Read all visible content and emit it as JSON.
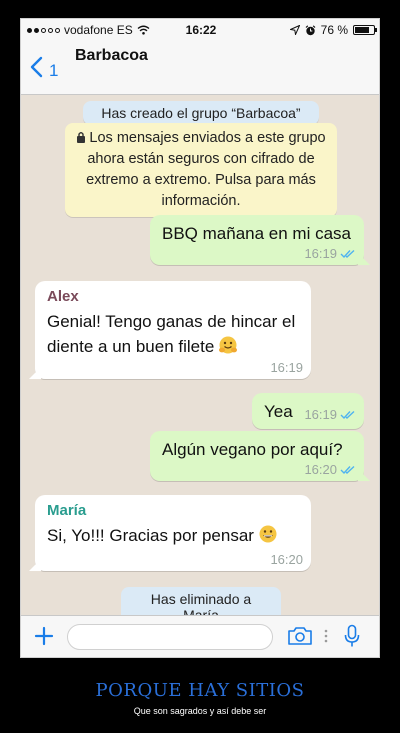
{
  "status_bar": {
    "carrier": "vodafone ES",
    "time": "16:22",
    "battery": "76 %",
    "battery_level": 0.76
  },
  "header": {
    "back_count": "1",
    "chat_title": "Barbacoa"
  },
  "chat": {
    "system_created": "Has creado el grupo “Barbacoa”",
    "encryption_notice": "Los mensajes enviados a este grupo ahora están seguros con cifrado de extremo a extremo. Pulsa para más información.",
    "messages": [
      {
        "text": "BBQ mañana en mi casa",
        "time": "16:19"
      },
      {
        "sender": "Alex",
        "sender_color": "#7a4a5a",
        "text": "Genial! Tengo ganas de hincar el diente a un buen filete",
        "emoji": "hugging-face-emoji",
        "time": "16:19"
      },
      {
        "text": "Yea",
        "time": "16:19"
      },
      {
        "text": "Algún vegano por aquí?",
        "time": "16:20"
      },
      {
        "sender": "María",
        "sender_color": "#2a9d8f",
        "text": "Si, Yo!!! Gracias por pensar",
        "emoji": "grinning-face-emoji",
        "time": "16:20"
      }
    ],
    "system_removed": "Has eliminado a María"
  },
  "input_bar": {
    "placeholder": "",
    "icons": [
      "plus-icon",
      "camera-icon",
      "more-dots-icon",
      "microphone-icon"
    ]
  },
  "colors": {
    "accent": "#1a7de8",
    "outgoing_bubble": "#dcf8c6",
    "read_ticks": "#4fb3f0"
  },
  "caption": {
    "title": "PORQUE HAY SITIOS",
    "subtitle": "Que son sagrados y así debe ser"
  }
}
